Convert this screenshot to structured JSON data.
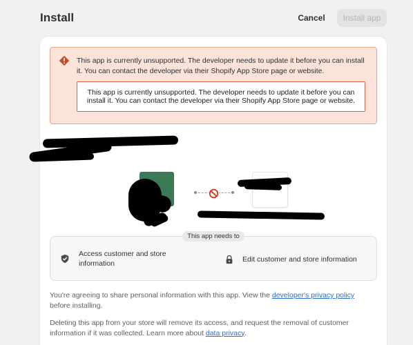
{
  "header": {
    "title": "Install",
    "cancel_label": "Cancel",
    "install_label": "Install app"
  },
  "banner": {
    "message": "This app is currently unsupported. The developer needs to update it before you can install it. You can contact the developer via their Shopify App Store page or website.",
    "inner_message": "This app is currently unsupported. The developer needs to update it before you can install it. You can contact the developer via their Shopify App Store page or website.",
    "icon": "alert-diamond-icon",
    "color": "#c74b2b"
  },
  "connection": {
    "app_logo_color": "#3c7a55",
    "status_icon": "no-entry-icon",
    "status_color": "#d72c0d"
  },
  "permissions": {
    "pill_label": "This app needs to",
    "items": [
      {
        "icon": "shield-icon",
        "label": "Access customer and store information"
      },
      {
        "icon": "lock-icon",
        "label": "Edit customer and store information"
      }
    ]
  },
  "footer": {
    "p1_before": "You're agreeing to share personal information with this app. View the ",
    "p1_link": "developer's privacy policy",
    "p1_after": " before installing.",
    "p2_before": "Deleting this app from your store will remove its access, and request the removal of customer information if it was collected. Learn more about ",
    "p2_link": "data privacy",
    "p2_after": "."
  }
}
